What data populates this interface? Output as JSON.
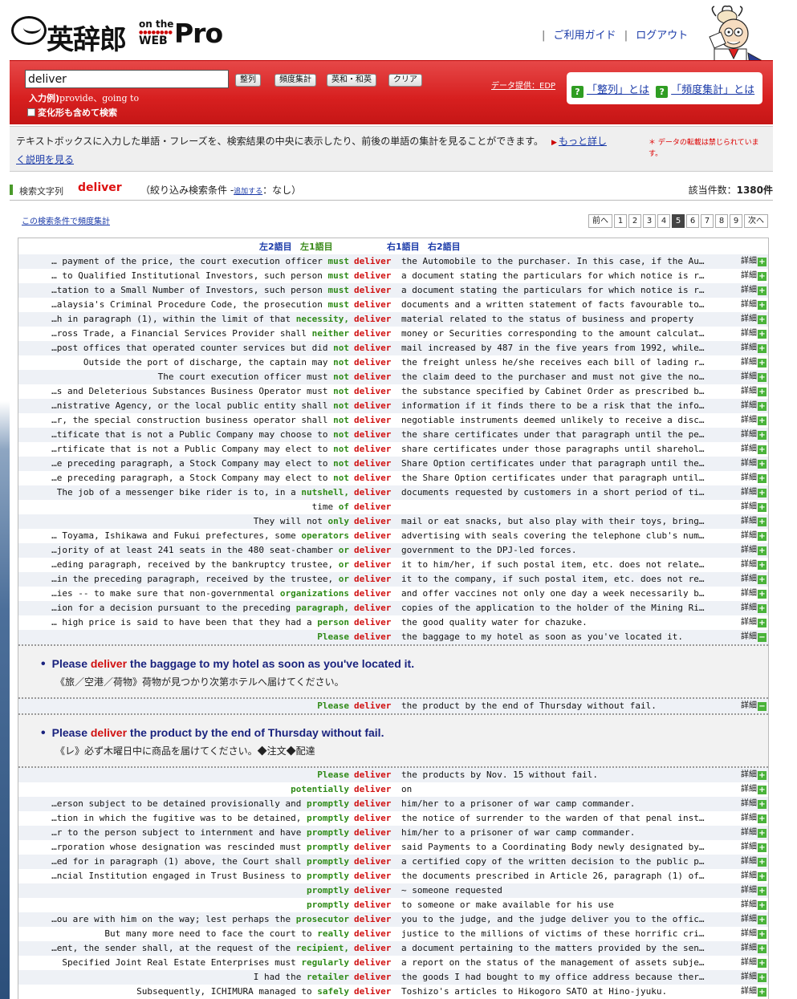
{
  "header": {
    "logo_jp": "英辞郎",
    "logo_onthe": "on the",
    "logo_web": "WEB",
    "logo_pro": "Pro",
    "nav": [
      "ご利用ガイド",
      "ログアウト"
    ]
  },
  "search": {
    "value": "deliver",
    "buttons": [
      "整列",
      "頻度集計",
      "英和・和英",
      "クリア"
    ],
    "example_label": "入力例)",
    "example_text": "provide、going to",
    "variant_label": "変化形も含めて検索",
    "data_credit": "データ提供：EDP",
    "help": [
      "「整列」とは",
      "「頻度集計」とは"
    ]
  },
  "description": {
    "text": "テキストボックスに入力した単語・フレーズを、検索結果の中央に表示したり、前後の単語の集計を見ることができます。",
    "more": "もっと詳し",
    "learn": "く説明を見る",
    "notice": "＊ データの転載は禁じられています。"
  },
  "query": {
    "label": "検索文字列",
    "word": "deliver",
    "filter_prefix": "（絞り込み検索条件 -",
    "filter_add": "追加する",
    "filter_suffix": "：なし）",
    "count_label": "該当件数：",
    "count": "1380件"
  },
  "freq_link": "この検索条件で頻度集計",
  "pager": {
    "prev": "前へ",
    "pages": [
      "1",
      "2",
      "3",
      "4",
      "5",
      "6",
      "7",
      "8",
      "9"
    ],
    "current": "5",
    "next": "次へ"
  },
  "columns": {
    "left2": "左2語目",
    "left1": "左1語目",
    "right1": "右1語目",
    "right2": "右2語目"
  },
  "detail_label": "詳細",
  "rows": [
    {
      "l": "… payment of the price, the court execution officer ",
      "c": "must",
      "k": "deliver",
      "r": "the Automobile to the purchaser. In this case, if the Au…"
    },
    {
      "l": "… to Qualified Institutional Investors, such person ",
      "c": "must",
      "k": "deliver",
      "r": "a document stating the particulars for which notice is r…"
    },
    {
      "l": "…tation to a Small Number of Investors, such person ",
      "c": "must",
      "k": "deliver",
      "r": "a document stating the particulars for which notice is r…"
    },
    {
      "l": "…alaysia's Criminal Procedure Code, the prosecution ",
      "c": "must",
      "k": "deliver",
      "r": "documents and a written statement of facts favourable to…"
    },
    {
      "l": "…h in paragraph (1), within the limit of that ",
      "c": "necessity,",
      "k": "deliver",
      "r": "material related to the status of business and property"
    },
    {
      "l": "…ross Trade, a Financial Services Provider shall ",
      "c": "neither",
      "k": "deliver",
      "r": "money or Securities corresponding to the amount calculat…"
    },
    {
      "l": "…post offices that operated counter services but did ",
      "c": "not",
      "k": "deliver",
      "r": "mail increased by 487 in the five years from 1992, while…"
    },
    {
      "l": "Outside the port of discharge, the captain may ",
      "c": "not",
      "k": "deliver",
      "r": "the freight unless he/she receives each bill of lading r…"
    },
    {
      "l": "The court execution officer must ",
      "c": "not",
      "k": "deliver",
      "r": "the claim deed to the purchaser and must not give the no…"
    },
    {
      "l": "…s and Deleterious Substances Business Operator must ",
      "c": "not",
      "k": "deliver",
      "r": "the substance specified by Cabinet Order as prescribed b…"
    },
    {
      "l": "…nistrative Agency, or the local public entity shall ",
      "c": "not",
      "k": "deliver",
      "r": "information if it finds there to be a risk that the info…"
    },
    {
      "l": "…r, the special construction business operator shall ",
      "c": "not",
      "k": "deliver",
      "r": "negotiable instruments deemed unlikely to receive a disc…"
    },
    {
      "l": "…tificate that is not a Public Company may choose to ",
      "c": "not",
      "k": "deliver",
      "r": "the share certificates under that paragraph until the pe…"
    },
    {
      "l": "…rtificate that is not a Public Company may elect to ",
      "c": "not",
      "k": "deliver",
      "r": "share certificates under those paragraphs until sharehol…"
    },
    {
      "l": "…e preceding paragraph, a Stock Company may elect to ",
      "c": "not",
      "k": "deliver",
      "r": "Share Option certificates under that paragraph until the…"
    },
    {
      "l": "…e preceding paragraph, a Stock Company may elect to ",
      "c": "not",
      "k": "deliver",
      "r": "the Share Option certificates under that paragraph until…"
    },
    {
      "l": "The job of a messenger bike rider is to, in a ",
      "c": "nutshell,",
      "k": "deliver",
      "r": "documents requested by customers in a short period of ti…"
    },
    {
      "l": "time ",
      "c": "of",
      "k": "deliver",
      "r": ""
    },
    {
      "l": "They will not ",
      "c": "only",
      "k": "deliver",
      "r": "mail or eat snacks, but also play with their toys, bring…"
    },
    {
      "l": "… Toyama, Ishikawa and Fukui prefectures, some ",
      "c": "operators",
      "k": "deliver",
      "r": "advertising with seals covering the telephone club's num…"
    },
    {
      "l": "…jority of at least 241 seats in the 480 seat-chamber ",
      "c": "or",
      "k": "deliver",
      "r": "government to the DPJ-led forces."
    },
    {
      "l": "…eding paragraph, received by the bankruptcy trustee, ",
      "c": "or",
      "k": "deliver",
      "r": "it to him/her, if such postal item, etc. does not relate…"
    },
    {
      "l": "…in the preceding paragraph, received by the trustee, ",
      "c": "or",
      "k": "deliver",
      "r": "it to the company, if such postal item, etc. does not re…"
    },
    {
      "l": "…ies -- to make sure that non-governmental ",
      "c": "organizations",
      "k": "deliver",
      "r": "and offer vaccines not only one day a week necessarily b…"
    },
    {
      "l": "…ion for a decision pursuant to the preceding ",
      "c": "paragraph,",
      "k": "deliver",
      "r": "copies of the application to the holder of the Mining Ri…"
    },
    {
      "l": "… high price is said to have been that they had a ",
      "c": "person",
      "k": "deliver",
      "r": "the good quality water for chazuke."
    }
  ],
  "expanded": [
    {
      "row": {
        "l": "",
        "c": "Please",
        "k": "deliver",
        "r": "the baggage to my hotel as soon as you've located it."
      },
      "en_pre": "Please ",
      "en_key": "deliver",
      "en_post": " the baggage to my hotel as soon as you've located it.",
      "jp": "《旅／空港／荷物》荷物が見つかり次第ホテルへ届けてください。"
    },
    {
      "row": {
        "l": "",
        "c": "Please",
        "k": "deliver",
        "r": "the product by the end of Thursday without fail."
      },
      "en_pre": "Please ",
      "en_key": "deliver",
      "en_post": " the product by the end of Thursday without fail.",
      "jp": "《レ》必ず木曜日中に商品を届けてください。◆注文◆配達"
    }
  ],
  "rows2": [
    {
      "l": "",
      "c": "Please",
      "k": "deliver",
      "r": "the products by Nov. 15 without fail."
    },
    {
      "l": "",
      "c": "potentially",
      "k": "deliver",
      "r": "on"
    },
    {
      "l": "…erson subject to be detained provisionally and ",
      "c": "promptly",
      "k": "deliver",
      "r": "him/her to a prisoner of war camp commander."
    },
    {
      "l": "…tion in which the fugitive was to be detained, ",
      "c": "promptly",
      "k": "deliver",
      "r": "the notice of surrender to the warden of that penal inst…"
    },
    {
      "l": "…r to the person subject to internment and have ",
      "c": "promptly",
      "k": "deliver",
      "r": "him/her to a prisoner of war camp commander."
    },
    {
      "l": "…rporation whose designation was rescinded must ",
      "c": "promptly",
      "k": "deliver",
      "r": "said Payments to a Coordinating Body newly designated by…"
    },
    {
      "l": "…ed for in paragraph (1) above, the Court shall ",
      "c": "promptly",
      "k": "deliver",
      "r": "a certified copy of the written decision to the public p…"
    },
    {
      "l": "…ncial Institution engaged in Trust Business to ",
      "c": "promptly",
      "k": "deliver",
      "r": "the documents prescribed in Article 26, paragraph (1) of…"
    },
    {
      "l": "",
      "c": "promptly",
      "k": "deliver",
      "r": "~ someone requested"
    },
    {
      "l": "",
      "c": "promptly",
      "k": "deliver",
      "r": "to someone or make available for his use"
    },
    {
      "l": "…ou are with him on the way; lest perhaps the ",
      "c": "prosecutor",
      "k": "deliver",
      "r": "you to the judge, and the judge deliver you to the offic…"
    },
    {
      "l": "But many more need to face the court to ",
      "c": "really",
      "k": "deliver",
      "r": "justice to the millions of victims of these horrific cri…"
    },
    {
      "l": "…ent, the sender shall, at the request of the ",
      "c": "recipient,",
      "k": "deliver",
      "r": "a document pertaining to the matters provided by the sen…"
    },
    {
      "l": "Specified Joint Real Estate Enterprises must ",
      "c": "regularly",
      "k": "deliver",
      "r": "a report on the status of the management of assets subje…"
    },
    {
      "l": "I had the ",
      "c": "retailer",
      "k": "deliver",
      "r": "the goods I had bought to my office address because ther…"
    },
    {
      "l": "Subsequently, ICHIMURA managed to ",
      "c": "safely",
      "k": "deliver",
      "r": "Toshizo's articles to Hikogoro SATO at Hino-jyuku."
    }
  ]
}
